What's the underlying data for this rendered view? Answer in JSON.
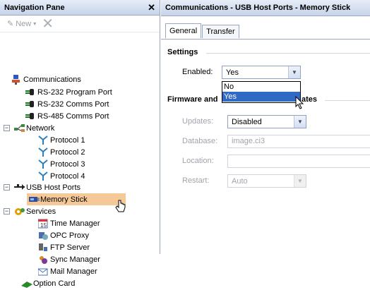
{
  "nav": {
    "title": "Navigation Pane",
    "toolbar": {
      "new_label": "New"
    },
    "items": [
      {
        "label": "Communications"
      },
      {
        "label": "RS-232 Program Port"
      },
      {
        "label": "RS-232 Comms Port"
      },
      {
        "label": "RS-485 Comms Port"
      },
      {
        "label": "Network"
      },
      {
        "label": "Protocol 1"
      },
      {
        "label": "Protocol 2"
      },
      {
        "label": "Protocol 3"
      },
      {
        "label": "Protocol 4"
      },
      {
        "label": "USB Host Ports"
      },
      {
        "label": "Memory Stick"
      },
      {
        "label": "Services"
      },
      {
        "label": "Time Manager"
      },
      {
        "label": "OPC Proxy"
      },
      {
        "label": "FTP Server"
      },
      {
        "label": "Sync Manager"
      },
      {
        "label": "Mail Manager"
      },
      {
        "label": "Option Card"
      }
    ]
  },
  "main": {
    "title": "Communications - USB Host Ports - Memory Stick",
    "tabs": [
      {
        "label": "General"
      },
      {
        "label": "Transfer"
      }
    ],
    "settings": {
      "group_title": "Settings",
      "enabled_label": "Enabled:",
      "enabled_value": "Yes",
      "options": [
        "No",
        "Yes"
      ]
    },
    "firmware": {
      "group_title_left": "Firmware and",
      "group_title_right": "ates",
      "updates_label": "Updates:",
      "updates_value": "Disabled",
      "database_label": "Database:",
      "database_value": "image.ci3",
      "location_label": "Location:",
      "location_value": "",
      "restart_label": "Restart:",
      "restart_value": "Auto"
    }
  },
  "colors": {
    "header_gradient_top": "#e7edf8",
    "header_gradient_bottom": "#c6d3ea",
    "selection": "#f5c898",
    "dropdown_highlight": "#316ac5"
  }
}
